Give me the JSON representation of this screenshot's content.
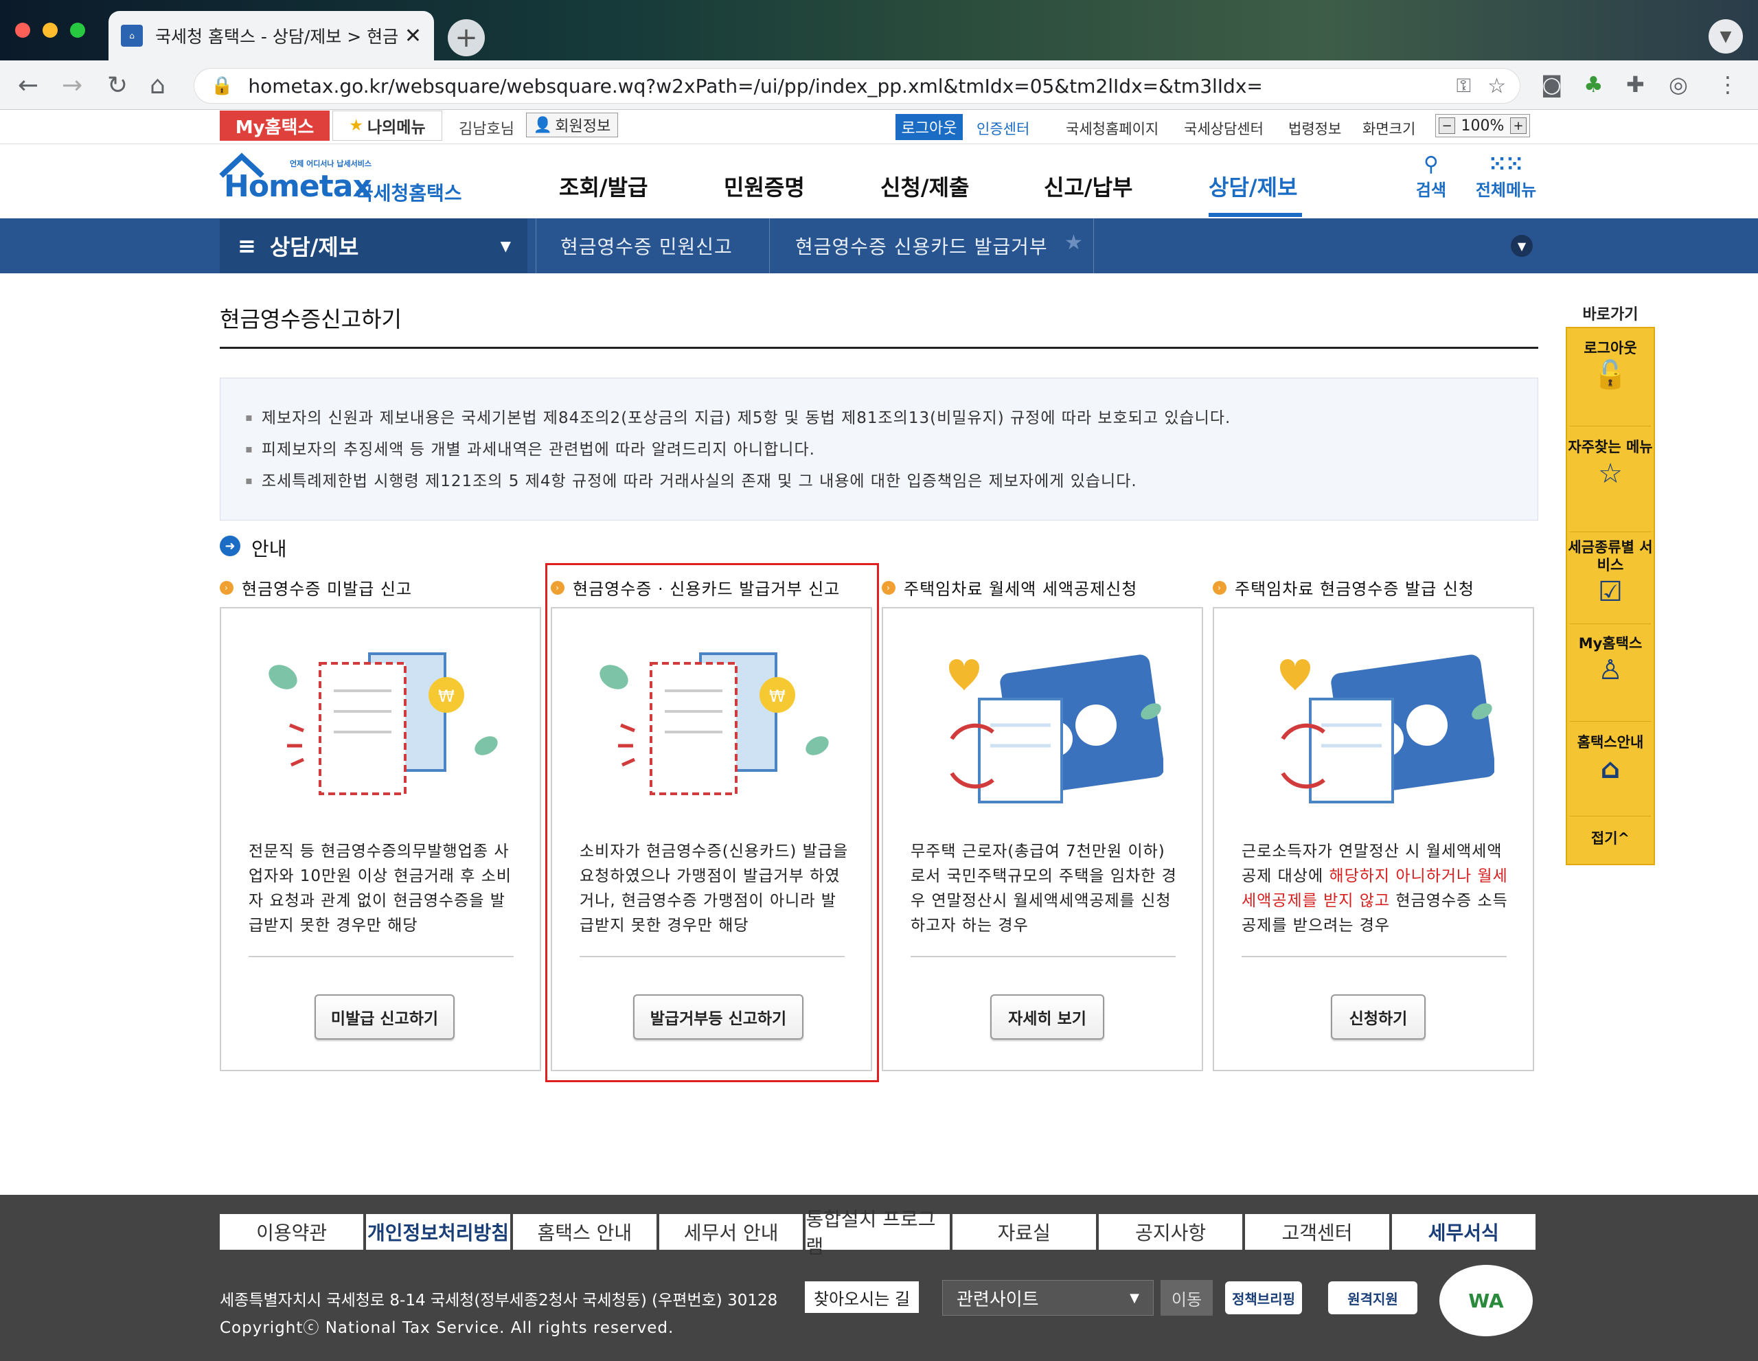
{
  "browser": {
    "tab_title": "국세청 홈택스 - 상담/제보 > 현금영",
    "url": "hometax.go.kr/websquare/websquare.wq?w2xPath=/ui/pp/index_pp.xml&tmIdx=05&tm2lIdx=&tm3lIdx="
  },
  "topbar": {
    "my_hometax": "My홈택스",
    "my_menu": "나의메뉴",
    "user_name": "김남호님",
    "member_info": "회원정보",
    "logout": "로그아웃",
    "cert_center": "인증센터",
    "links": [
      "국세청홈페이지",
      "국세상담센터",
      "법령정보",
      "화면크기"
    ],
    "zoom": "100%"
  },
  "gnb": {
    "logo_small": "언제 어디서나 납세서비스",
    "logo_main": "Hometax",
    "logo_kr": "국세청홈택스",
    "items": [
      "조회/발급",
      "민원증명",
      "신청/제출",
      "신고/납부",
      "상담/제보"
    ],
    "search": "검색",
    "all_menu": "전체메뉴"
  },
  "location": {
    "main": "상담/제보",
    "sub1": "현금영수증 민원신고",
    "sub2": "현금영수증 신용카드 발급거부"
  },
  "page": {
    "title": "현금영수증신고하기",
    "notices": [
      "제보자의 신원과 제보내용은 국세기본법 제84조의2(포상금의 지급) 제5항 및 동법 제81조의13(비밀유지) 규정에 따라 보호되고 있습니다.",
      "피제보자의 추징세액 등 개별 과세내역은 관련법에 따라 알려드리지 아니합니다.",
      "조세특례제한법 시행령 제121조의 5 제4항 규정에 따라 거래사실의 존재 및 그 내용에 대한 입증책임은 제보자에게 있습니다."
    ],
    "guide_label": "안내",
    "cards": [
      {
        "title": "현금영수증 미발급 신고",
        "desc": "전문직 등 현금영수증의무발행업종 사업자와 10만원 이상 현금거래 후 소비자 요청과 관계 없이 현금영수증을 발급받지 못한 경우만 해당",
        "button": "미발급 신고하기"
      },
      {
        "title": "현금영수증 · 신용카드 발급거부 신고",
        "desc": "소비자가 현금영수증(신용카드) 발급을 요청하였으나 가맹점이 발급거부 하였거나, 현금영수증 가맹점이 아니라 발급받지 못한 경우만 해당",
        "button": "발급거부등 신고하기"
      },
      {
        "title": "주택임차료 월세액 세액공제신청",
        "desc": "무주택 근로자(총급여 7천만원 이하)로서 국민주택규모의 주택을 임차한 경우 연말정산시 월세액세액공제를 신청하고자 하는 경우",
        "button": "자세히 보기"
      },
      {
        "title": "주택임차료 현금영수증 발급 신청",
        "desc_a": "근로소득자가 연말정산 시 월세액세액공제 대상에 ",
        "desc_red": "해당하지 아니하거나 월세세액공제를 받지 않고",
        "desc_b": " 현금영수증 소득공제를 받으려는 경우",
        "button": "신청하기"
      }
    ]
  },
  "quickmenu": {
    "label": "바로가기",
    "items": [
      "로그아웃",
      "자주찾는 메뉴",
      "세금종류별 서비스",
      "My홈택스",
      "홈택스안내"
    ],
    "fold": "접기^"
  },
  "footer": {
    "menu": [
      "이용약관",
      "개인정보처리방침",
      "홈택스 안내",
      "세무서 안내",
      "통합설치 프로그램",
      "자료실",
      "공지사항",
      "고객센터",
      "세무서식"
    ],
    "address": "세종특별자치시 국세청로 8-14 국세청(정부세종2청사 국세청동) (우편번호) 30128",
    "find_way": "찾아오시는 길",
    "copyright": "Copyrightⓒ National Tax Service. All rights reserved.",
    "related_sites": "관련사이트",
    "go": "이동",
    "badge1": "정책브리핑",
    "badge2": "원격지원",
    "wa": "WA"
  },
  "colors": {
    "brand_blue": "#1a6cc4",
    "location_bar": "#28558f",
    "my_hometax_red": "#e0403b",
    "quickmenu_yellow": "#f4c433",
    "highlight_red": "#e02020"
  }
}
